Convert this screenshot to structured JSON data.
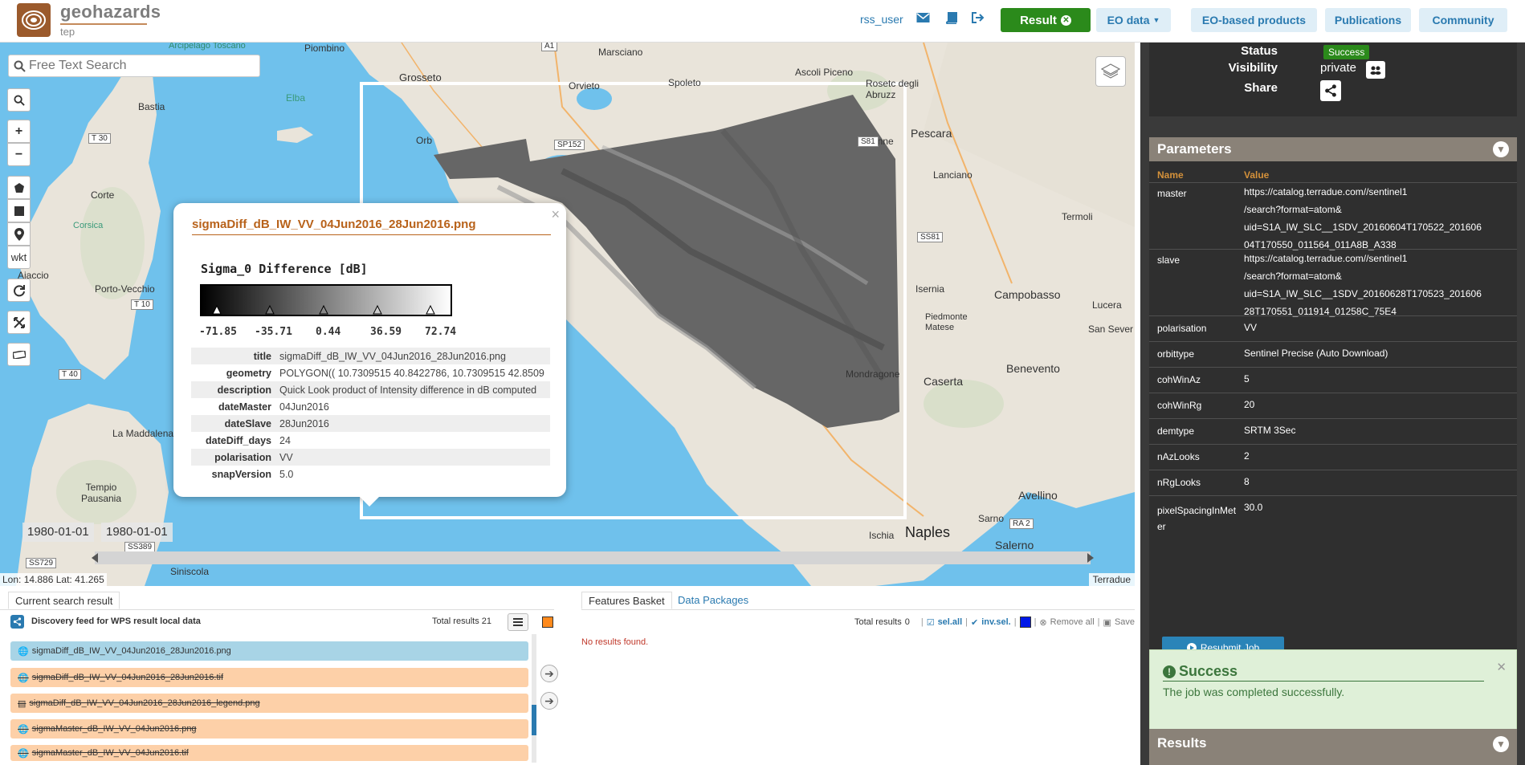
{
  "app": {
    "name": "geohazards",
    "sub": "tep"
  },
  "header": {
    "user": "rss_user",
    "result_label": "Result",
    "nav": [
      {
        "label": "EO data"
      },
      {
        "label": "EO-based products"
      },
      {
        "label": "Publications"
      },
      {
        "label": "Community"
      }
    ]
  },
  "map": {
    "search_placeholder": "Free Text Search",
    "wkt_label": "wkt",
    "coords": "Lon: 14.886 Lat: 41.265",
    "attribution": "Terradue",
    "date_from": "1980-01-01",
    "date_to": "1980-01-01",
    "places": [
      "Piombino",
      "Grosseto",
      "Marsciano",
      "Ascoli Piceno",
      "Orvieto",
      "Spoleto",
      "Rosetc degli Abruzz",
      "Bastia",
      "Elba",
      "Corte",
      "Corsica",
      "Ajaccio",
      "Orb",
      "Pescara",
      "Penne",
      "Lanciano",
      "Termoli",
      "Isernia",
      "Campobasso",
      "Lucera",
      "Piedmonte Matese",
      "Benevento",
      "Caserta",
      "Mondragone",
      "Naples",
      "Ischia",
      "Avellino",
      "Sarno",
      "Salerno",
      "San Sever",
      "Porto-Vecchio",
      "La Maddalena",
      "Tempio Pausania",
      "Siniscola",
      "Arcipelago Toscano",
      "A1",
      "SP152",
      "S81",
      "SS81",
      "T 30",
      "T 10",
      "T 40",
      "RA 2",
      "SS729",
      "SS389"
    ]
  },
  "popup": {
    "title": "sigmaDiff_dB_IW_VV_04Jun2016_28Jun2016.png",
    "legend_title": "Sigma_0 Difference [dB]",
    "legend_ticks": [
      "-71.85",
      "-35.71",
      "0.44",
      "36.59",
      "72.74"
    ],
    "rows": [
      {
        "k": "title",
        "v": "sigmaDiff_dB_IW_VV_04Jun2016_28Jun2016.png"
      },
      {
        "k": "geometry",
        "v": "POLYGON(( 10.7309515 40.8422786, 10.7309515 42.8509"
      },
      {
        "k": "description",
        "v": "Quick Look product of Intensity difference in dB computed"
      },
      {
        "k": "dateMaster",
        "v": "04Jun2016"
      },
      {
        "k": "dateSlave",
        "v": "28Jun2016"
      },
      {
        "k": "dateDiff_days",
        "v": "24"
      },
      {
        "k": "polarisation",
        "v": "VV"
      },
      {
        "k": "snapVersion",
        "v": "5.0"
      }
    ]
  },
  "bottom": {
    "tab_current": "Current search result",
    "feed_title": "Discovery feed for WPS result local data",
    "total_label": "Total results",
    "total_value": "21",
    "items": [
      {
        "label": "sigmaDiff_dB_IW_VV_04Jun2016_28Jun2016.png",
        "selected": true,
        "icon": "globe"
      },
      {
        "label": "sigmaDiff_dB_IW_VV_04Jun2016_28Jun2016.tif",
        "selected": false,
        "icon": "globe"
      },
      {
        "label": "sigmaDiff_dB_IW_VV_04Jun2016_28Jun2016_legend.png",
        "selected": false,
        "icon": "file"
      },
      {
        "label": "sigmaMaster_dB_IW_VV_04Jun2016.png",
        "selected": false,
        "icon": "globe"
      },
      {
        "label": "sigmaMaster_dB_IW_VV_04Jun2016.tif",
        "selected": false,
        "icon": "globe"
      }
    ],
    "tab_basket": "Features Basket",
    "tab_packages": "Data Packages",
    "basket_total_label": "Total results",
    "basket_total_value": "0",
    "sel_all": "sel.all",
    "inv_sel": "inv.sel.",
    "remove_all": "Remove all",
    "save": "Save",
    "no_results": "No results found."
  },
  "job": {
    "status_label": "Status",
    "status_value": "Success",
    "visibility_label": "Visibility",
    "visibility_value": "private",
    "share_label": "Share"
  },
  "parameters": {
    "title": "Parameters",
    "col_name": "Name",
    "col_value": "Value",
    "rows": [
      {
        "name": "master",
        "value": [
          "https://catalog.terradue.com//sentinel1",
          "/search?format=atom&",
          "uid=S1A_IW_SLC__1SDV_20160604T170522_201606",
          "04T170550_011564_011A8B_A338"
        ]
      },
      {
        "name": "slave",
        "value": [
          "https://catalog.terradue.com//sentinel1",
          "/search?format=atom&",
          "uid=S1A_IW_SLC__1SDV_20160628T170523_201606",
          "28T170551_011914_01258C_75E4"
        ]
      },
      {
        "name": "polarisation",
        "value": [
          "VV"
        ]
      },
      {
        "name": "orbittype",
        "value": [
          "Sentinel Precise (Auto Download)"
        ]
      },
      {
        "name": "cohWinAz",
        "value": [
          "5"
        ]
      },
      {
        "name": "cohWinRg",
        "value": [
          "20"
        ]
      },
      {
        "name": "demtype",
        "value": [
          "SRTM 3Sec"
        ]
      },
      {
        "name": "nAzLooks",
        "value": [
          "2"
        ]
      },
      {
        "name": "nRgLooks",
        "value": [
          "8"
        ]
      },
      {
        "name": "pixelSpacingInMet er",
        "value": [
          "30.0"
        ]
      }
    ],
    "resubmit": "Resubmit Job"
  },
  "alert": {
    "title": "Success",
    "body": "The job was completed successfully."
  },
  "results_panel": {
    "title": "Results"
  },
  "colors": {
    "accent": "#2a7ab0",
    "brand": "#9b5a2c",
    "success": "#2b8a1b",
    "selected_row": "#a8d4e6",
    "item_row": "#fdd0a8"
  }
}
